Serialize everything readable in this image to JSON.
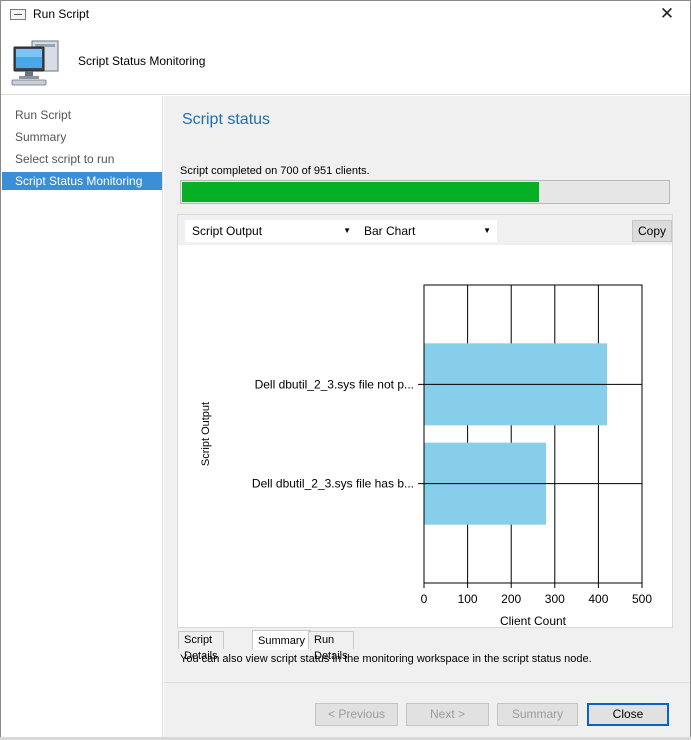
{
  "window": {
    "title": "Run Script",
    "close_glyph": "✕",
    "icon": "window-icon"
  },
  "header": {
    "icon": "computer-monitor-icon",
    "title": "Script Status Monitoring"
  },
  "nav": {
    "items": [
      {
        "label": "Run Script",
        "active": false
      },
      {
        "label": "Summary",
        "active": false
      },
      {
        "label": "Select script to run",
        "active": false
      },
      {
        "label": "Script Status Monitoring",
        "active": true
      }
    ]
  },
  "main": {
    "section_title": "Script status",
    "status_text": "Script completed on 700 of 951 clients.",
    "progress": {
      "completed": 700,
      "total": 951,
      "color": "#06b025"
    },
    "output_select": "Script Output",
    "view_select": "Bar Chart",
    "copy_label": "Copy",
    "tabs": [
      {
        "label": "Script Details",
        "active": false
      },
      {
        "label": "Summary",
        "active": true
      },
      {
        "label": "Run Details",
        "active": false
      }
    ],
    "info_text": "You can also view script status in the monitoring workspace in the script status node."
  },
  "chart_data": {
    "type": "bar",
    "orientation": "horizontal",
    "categories": [
      "Dell dbutil_2_3.sys file not p...",
      "Dell dbutil_2_3.sys file has b..."
    ],
    "values": [
      420,
      280
    ],
    "xlabel": "Client Count",
    "ylabel": "Script Output",
    "xlim": [
      0,
      500
    ],
    "xticks": [
      0,
      100,
      200,
      300,
      400,
      500
    ],
    "grid": true,
    "bar_color": "#87ceeb"
  },
  "footer": {
    "previous_label": "< Previous",
    "next_label": "Next >",
    "summary_label": "Summary",
    "close_label": "Close"
  }
}
